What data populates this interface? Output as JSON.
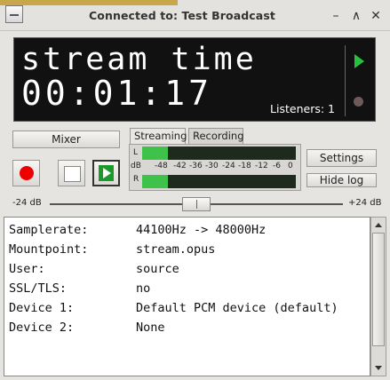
{
  "window": {
    "title": "Connected to: Test Broadcast",
    "minimize": "–",
    "maximize": "∧",
    "close": "✕"
  },
  "display": {
    "line1": "stream time",
    "line2": "00:01:17",
    "listeners": "Listeners: 1"
  },
  "controls": {
    "mixer": "Mixer",
    "settings": "Settings",
    "hide_log": "Hide log"
  },
  "meter": {
    "tabs": [
      "Streaming",
      "Recording"
    ],
    "label_l": "L",
    "label_db": "dB",
    "label_r": "R",
    "scale": [
      "-48",
      "-42",
      "-36",
      "-30",
      "-24",
      "-18",
      "-12",
      "-6",
      "0"
    ],
    "level_l": 0.17,
    "level_r": 0.17
  },
  "slider": {
    "min_label": "-24 dB",
    "max_label": "+24 dB",
    "value_fraction": 0.5
  },
  "log": [
    {
      "key": "Samplerate:",
      "value": "44100Hz -> 48000Hz"
    },
    {
      "key": "Mountpoint:",
      "value": "stream.opus"
    },
    {
      "key": "User:",
      "value": "source"
    },
    {
      "key": "SSL/TLS:",
      "value": "no"
    },
    {
      "key": "Device 1:",
      "value": "Default PCM device (default)"
    },
    {
      "key": "Device 2:",
      "value": "None"
    }
  ],
  "colors": {
    "accent_green": "#27c23d",
    "record_red": "#e00000",
    "display_bg": "#111111"
  }
}
